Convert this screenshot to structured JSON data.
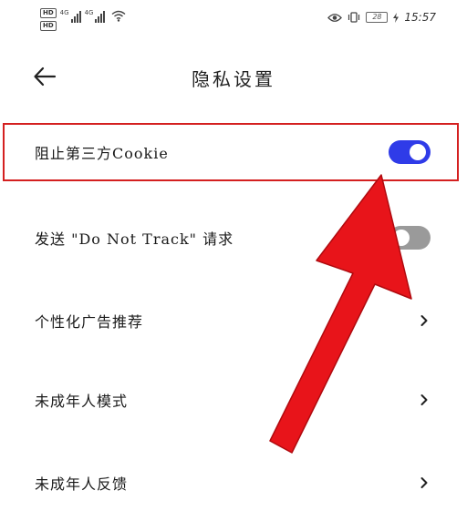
{
  "status_bar": {
    "hd1": "HD",
    "hd2": "HD",
    "sim1_net": "4G",
    "sim2_net": "4G",
    "time": "15:57",
    "battery": "28"
  },
  "header": {
    "title": "隐私设置"
  },
  "settings": {
    "items": [
      {
        "label": "阻止第三方Cookie",
        "control": "toggle",
        "state": "on"
      },
      {
        "label": "发送 \"Do Not Track\" 请求",
        "control": "toggle",
        "state": "off"
      },
      {
        "label": "个性化广告推荐",
        "control": "chevron"
      },
      {
        "label": "未成年人模式",
        "control": "chevron"
      },
      {
        "label": "未成年人反馈",
        "control": "chevron"
      }
    ]
  },
  "colors": {
    "toggle_on": "#2f3be8",
    "toggle_off": "#9a9a9a",
    "highlight_border": "#d42020",
    "annotation_arrow": "#e8141a"
  },
  "icons": {
    "back": "arrow-left-icon",
    "chevron": "chevron-right-icon",
    "wifi": "wifi-icon",
    "eye": "eye-icon",
    "vibrate": "vibrate-icon",
    "battery": "battery-icon",
    "charging": "charging-icon"
  }
}
